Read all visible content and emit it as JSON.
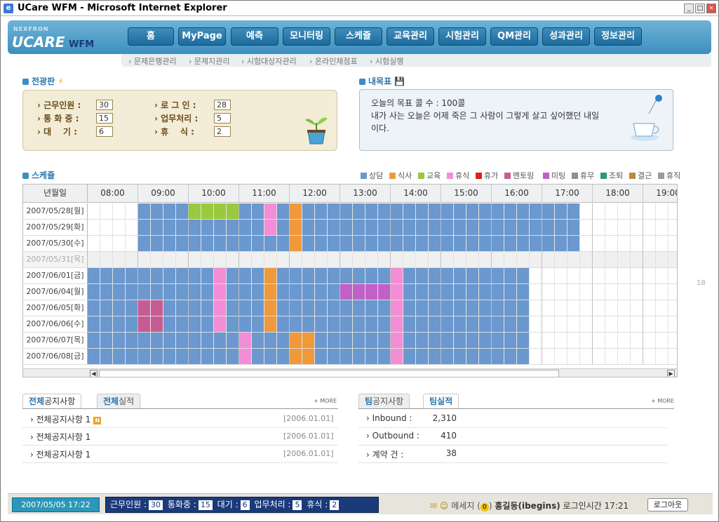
{
  "window": {
    "title": "UCare WFM - Microsoft Internet Explorer"
  },
  "logo": {
    "top": "NEXFRON",
    "main": "UCARE",
    "sub": "WFM"
  },
  "nav": [
    "홈",
    "MyPage",
    "예측",
    "모니터링",
    "스케쥴",
    "교육관리",
    "시험관리",
    "QM관리",
    "성과관리",
    "정보관리"
  ],
  "subnav": [
    "문제은행관리",
    "문제지관리",
    "시험대상자관리",
    "온라인채점표",
    "시험실행"
  ],
  "board": {
    "title": "전광판",
    "items": [
      {
        "label": "근무인원",
        "value": "30"
      },
      {
        "label": "통 화 중",
        "value": "15"
      },
      {
        "label": "대    기",
        "value": "6"
      },
      {
        "label": "로 그 인",
        "value": "28"
      },
      {
        "label": "업무처리",
        "value": "5"
      },
      {
        "label": "휴    식",
        "value": "2"
      }
    ]
  },
  "goal": {
    "title": "내목표",
    "line1": "오늘의 목표 콜 수 : 100콜",
    "line2": "내가 사는 오늘은 어제 죽은 그 사람이 그렇게 살고 싶어했던 내일",
    "line3": "이다."
  },
  "schedule": {
    "title": "스케쥴",
    "date_header": "년월일",
    "legend": [
      {
        "name": "상담",
        "color": "#6a98cf"
      },
      {
        "name": "식사",
        "color": "#f0993a"
      },
      {
        "name": "교육",
        "color": "#99c93c"
      },
      {
        "name": "휴식",
        "color": "#f38ed6"
      },
      {
        "name": "휴가",
        "color": "#e02020"
      },
      {
        "name": "멘토링",
        "color": "#c75b93"
      },
      {
        "name": "미팅",
        "color": "#c060c8"
      },
      {
        "name": "휴무",
        "color": "#909090"
      },
      {
        "name": "조퇴",
        "color": "#2e9a6e"
      },
      {
        "name": "결근",
        "color": "#c08a3a"
      },
      {
        "name": "휴직",
        "color": "#9a9a9a"
      }
    ],
    "hours": [
      "08:00",
      "09:00",
      "10:00",
      "11:00",
      "12:00",
      "13:00",
      "14:00",
      "15:00",
      "16:00",
      "17:00",
      "18:00",
      "19:00"
    ],
    "rows": [
      {
        "date": "2007/05/28[월]",
        "segs": [
          [
            4,
            39,
            "상담"
          ],
          [
            8,
            12,
            "교육"
          ],
          [
            14,
            15,
            "휴식"
          ],
          [
            16,
            17,
            "식사"
          ]
        ]
      },
      {
        "date": "2007/05/29[화]",
        "segs": [
          [
            4,
            39,
            "상담"
          ],
          [
            14,
            15,
            "휴식"
          ],
          [
            16,
            17,
            "식사"
          ]
        ]
      },
      {
        "date": "2007/05/30[수]",
        "segs": [
          [
            4,
            39,
            "상담"
          ],
          [
            16,
            17,
            "식사"
          ]
        ]
      },
      {
        "date": "2007/05/31[목]",
        "segs": [],
        "gray": true
      },
      {
        "date": "2007/06/01[금]",
        "segs": [
          [
            0,
            35,
            "상담"
          ],
          [
            10,
            11,
            "휴식"
          ],
          [
            14,
            15,
            "식사"
          ],
          [
            24,
            25,
            "휴식"
          ]
        ]
      },
      {
        "date": "2007/06/04[월]",
        "segs": [
          [
            0,
            35,
            "상담"
          ],
          [
            10,
            11,
            "휴식"
          ],
          [
            14,
            15,
            "식사"
          ],
          [
            20,
            24,
            "미팅"
          ],
          [
            24,
            25,
            "휴식"
          ]
        ]
      },
      {
        "date": "2007/06/05[화]",
        "segs": [
          [
            0,
            35,
            "상담"
          ],
          [
            4,
            6,
            "멘토링"
          ],
          [
            10,
            11,
            "휴식"
          ],
          [
            14,
            15,
            "식사"
          ],
          [
            24,
            25,
            "휴식"
          ]
        ]
      },
      {
        "date": "2007/06/06[수]",
        "segs": [
          [
            0,
            35,
            "상담"
          ],
          [
            4,
            6,
            "멘토링"
          ],
          [
            10,
            11,
            "휴식"
          ],
          [
            14,
            15,
            "식사"
          ],
          [
            24,
            25,
            "휴식"
          ]
        ]
      },
      {
        "date": "2007/06/07[목]",
        "segs": [
          [
            0,
            35,
            "상담"
          ],
          [
            12,
            13,
            "휴식"
          ],
          [
            16,
            18,
            "식사"
          ],
          [
            24,
            25,
            "휴식"
          ]
        ]
      },
      {
        "date": "2007/06/08[금]",
        "segs": [
          [
            0,
            35,
            "상담"
          ],
          [
            12,
            13,
            "휴식"
          ],
          [
            16,
            18,
            "식사"
          ],
          [
            24,
            25,
            "휴식"
          ]
        ]
      }
    ]
  },
  "notices": {
    "tab1_a": "전체",
    "tab1_b": "공지사항",
    "tab2_a": "전체",
    "tab2_b": "실적",
    "more": "+ MORE",
    "items": [
      {
        "text": "전체공지사항 1",
        "date": "[2006.01.01]",
        "new": "N"
      },
      {
        "text": "전체공지사항 1",
        "date": "[2006.01.01]"
      },
      {
        "text": "전체공지사항 1",
        "date": "[2006.01.01]"
      }
    ]
  },
  "team": {
    "tab1_a": "팀",
    "tab1_b": "공지사항",
    "tab2_a": "팀",
    "tab2_b": "실적",
    "more": "+ MORE",
    "items": [
      {
        "label": "Inbound :",
        "value": "2,310"
      },
      {
        "label": "Outbound :",
        "value": "410"
      },
      {
        "label": "계약 건 :",
        "value": "38"
      }
    ]
  },
  "status": {
    "datetime": "2007/05/05 17:22",
    "l1": "근무인원 :",
    "v1": "30",
    "l2": "통화중 :",
    "v2": "15",
    "l3": "대기 :",
    "v3": "6",
    "l4": "업무처리 :",
    "v4": "5",
    "l5": "휴식 :",
    "v5": "2",
    "msg_label": "메세지 (",
    "msg_count": "0",
    "msg_close": ")",
    "user": "홍길동(ibegins)",
    "login_time": "로그인시간 17:21",
    "logout": "로그아웃"
  },
  "side_number": "18"
}
